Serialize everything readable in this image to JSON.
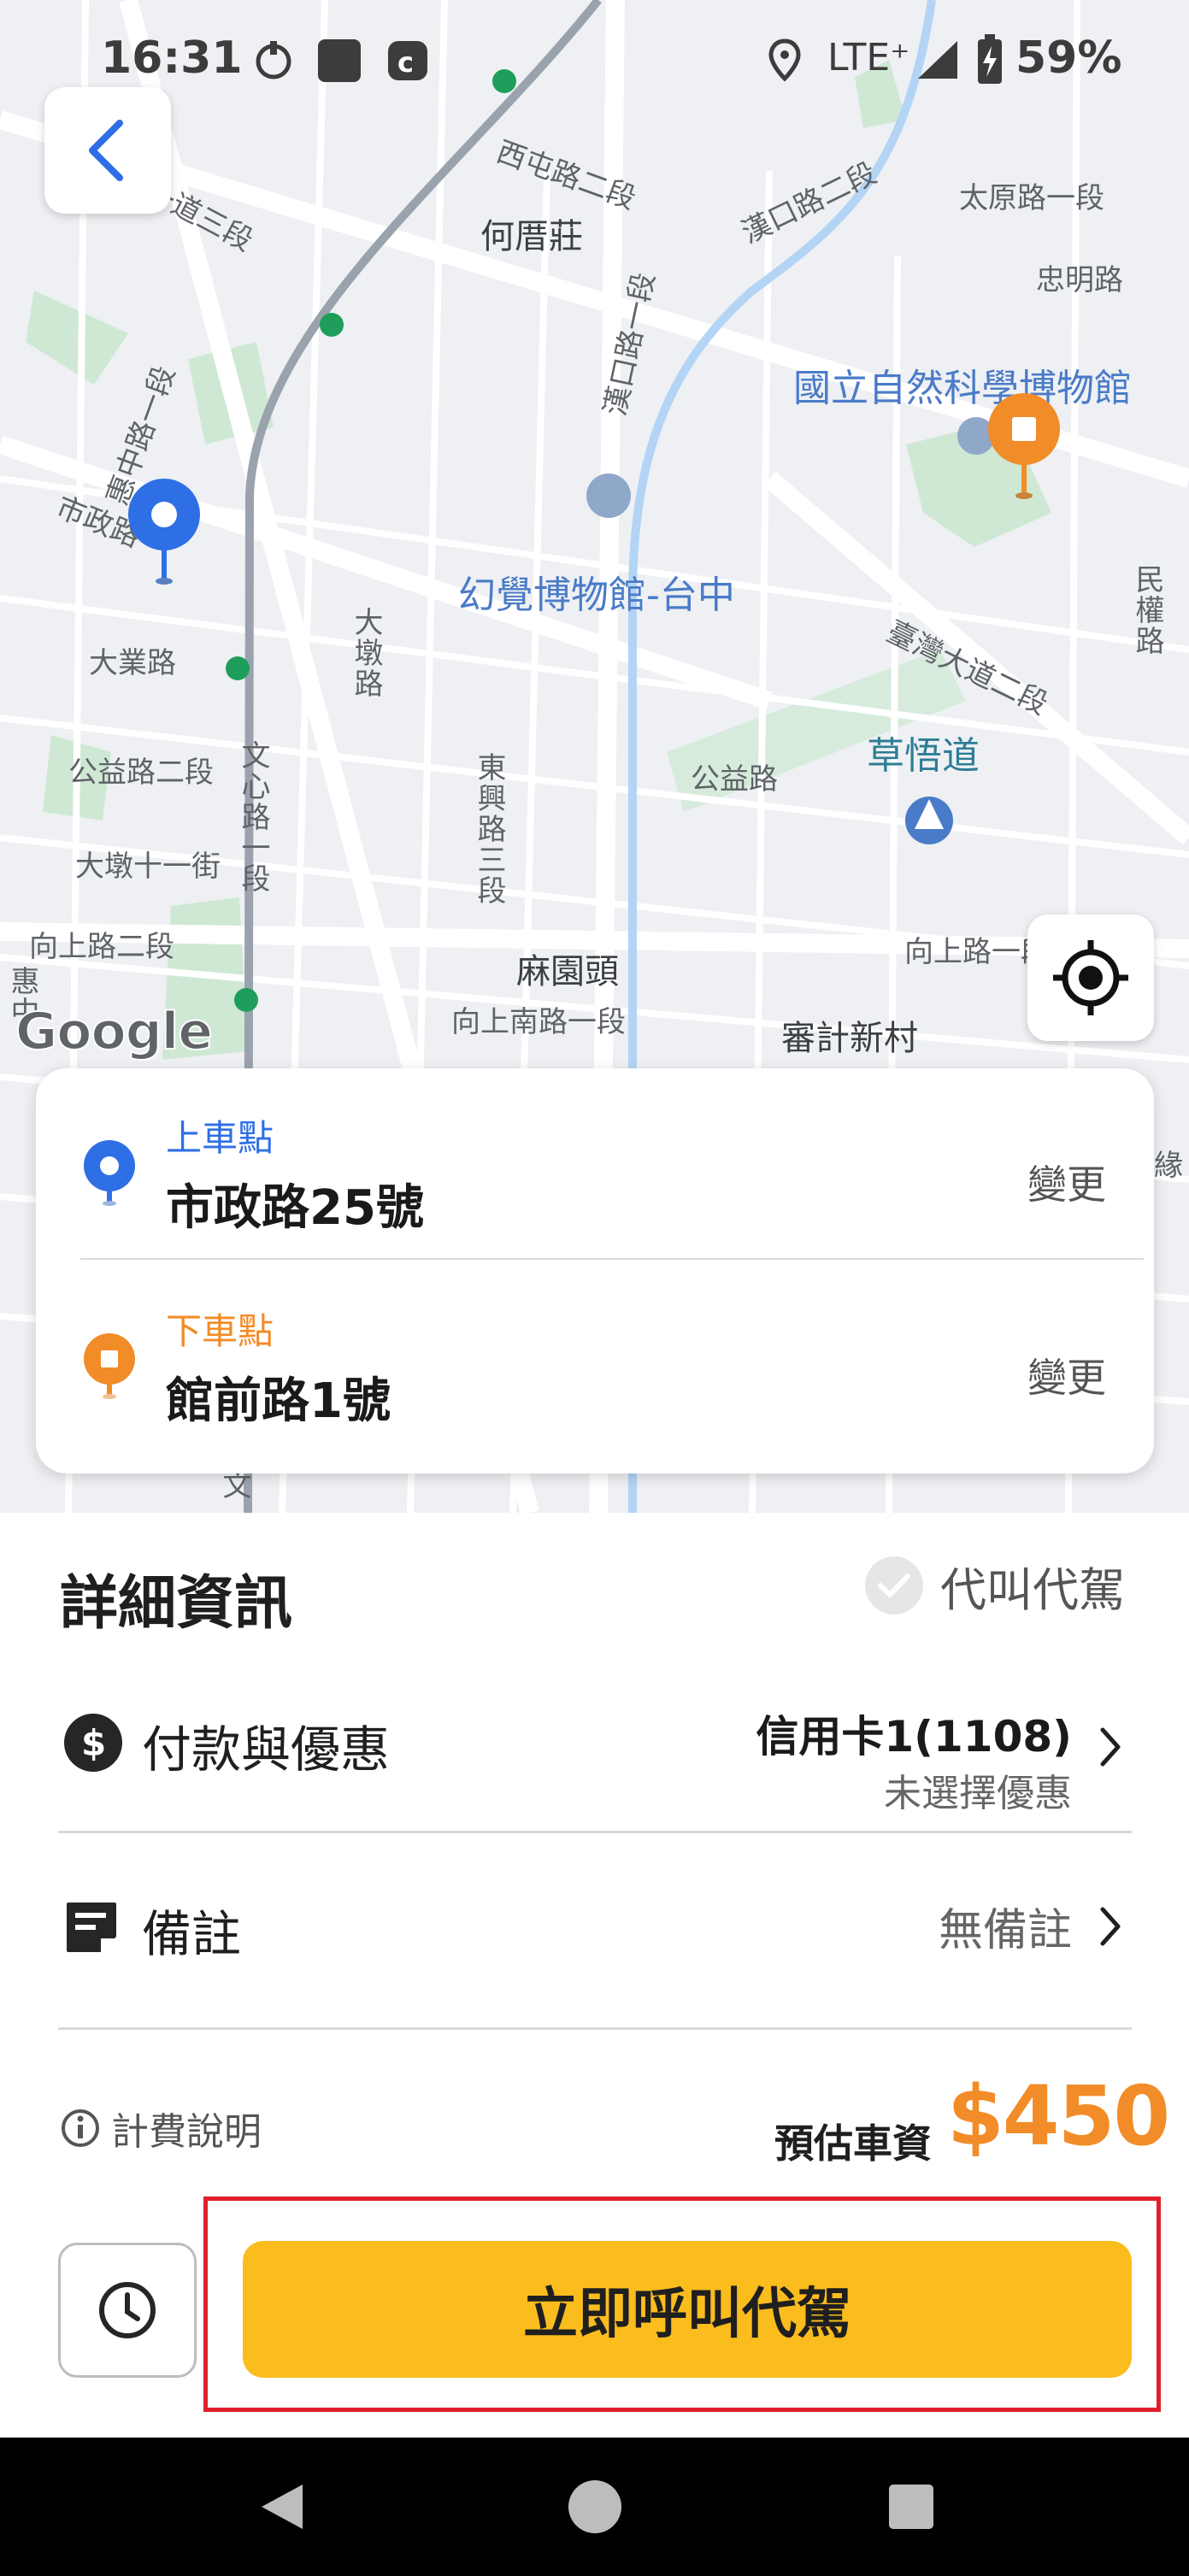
{
  "status_bar": {
    "time": "16:31",
    "network": "LTE⁺",
    "battery": "59%"
  },
  "map": {
    "labels": {
      "xitun_rd_2": "西屯路二段",
      "hanko_rd_2": "漢口路二段",
      "taiyuan_rd_1": "太原路一段",
      "zhongming_rd": "忠明路",
      "hecuozhuang": "何厝莊",
      "hanko_rd_1": "漢口路一段",
      "museum": "國立自然科學博物館",
      "huizhong_rd_1": "惠中路一段",
      "shizheng_rd": "市政路",
      "illusion_museum": "幻覺博物館-台中",
      "minquan_rd": "民權路",
      "taiwan_blvd_2": "臺灣大道二段",
      "daye_rd": "大業路",
      "dadun_rd": "大墩路",
      "gongyi_rd_2": "公益路二段",
      "wenxin_rd_1": "文心路一段",
      "dongxing_rd_3": "東興路三段",
      "gongyi_rd": "公益路",
      "caowudao": "草悟道",
      "dadun_11th": "大墩十一街",
      "xiangshang_rd_2": "向上路二段",
      "mayuantou": "麻園頭",
      "xiangshang_s_rd_1": "向上南路一段",
      "xiangshang_rd_1": "向上路一段",
      "shenji_village": "審計新村",
      "taiwan_blvd_3": "一道三段",
      "huizhong_rd": "惠中",
      "dadun_rd_2": "大墩",
      "wenxin_rd": "文",
      "edge_right": "緣"
    },
    "google_logo": "Google"
  },
  "route": {
    "pickup": {
      "label": "上車點",
      "address": "市政路25號",
      "change": "變更",
      "color": "#2f6fe6"
    },
    "dropoff": {
      "label": "下車點",
      "address": "館前路1號",
      "change": "變更",
      "color": "#f28c28"
    }
  },
  "details": {
    "title": "詳細資訊",
    "proxy_call": "代叫代駕",
    "payment": {
      "label": "付款與優惠",
      "card": "信用卡1(1108)",
      "coupon": "未選擇優惠"
    },
    "note": {
      "label": "備註",
      "value": "無備註"
    },
    "fare_info": "計費說明",
    "fare_estimate_label": "預估車資",
    "fare_amount": "$450"
  },
  "actions": {
    "call_now": "立即呼叫代駕"
  },
  "colors": {
    "accent_yellow": "#fbbc1e",
    "fare_orange": "#f28c28",
    "pickup_blue": "#2f6fe6",
    "highlight_red": "#e0202a"
  },
  "icons": [
    "back-chevron-icon",
    "locate-icon",
    "pickup-pin-icon",
    "dropoff-pin-icon",
    "dollar-icon",
    "note-icon",
    "info-icon",
    "clock-icon",
    "chevron-right-icon",
    "check-icon"
  ]
}
